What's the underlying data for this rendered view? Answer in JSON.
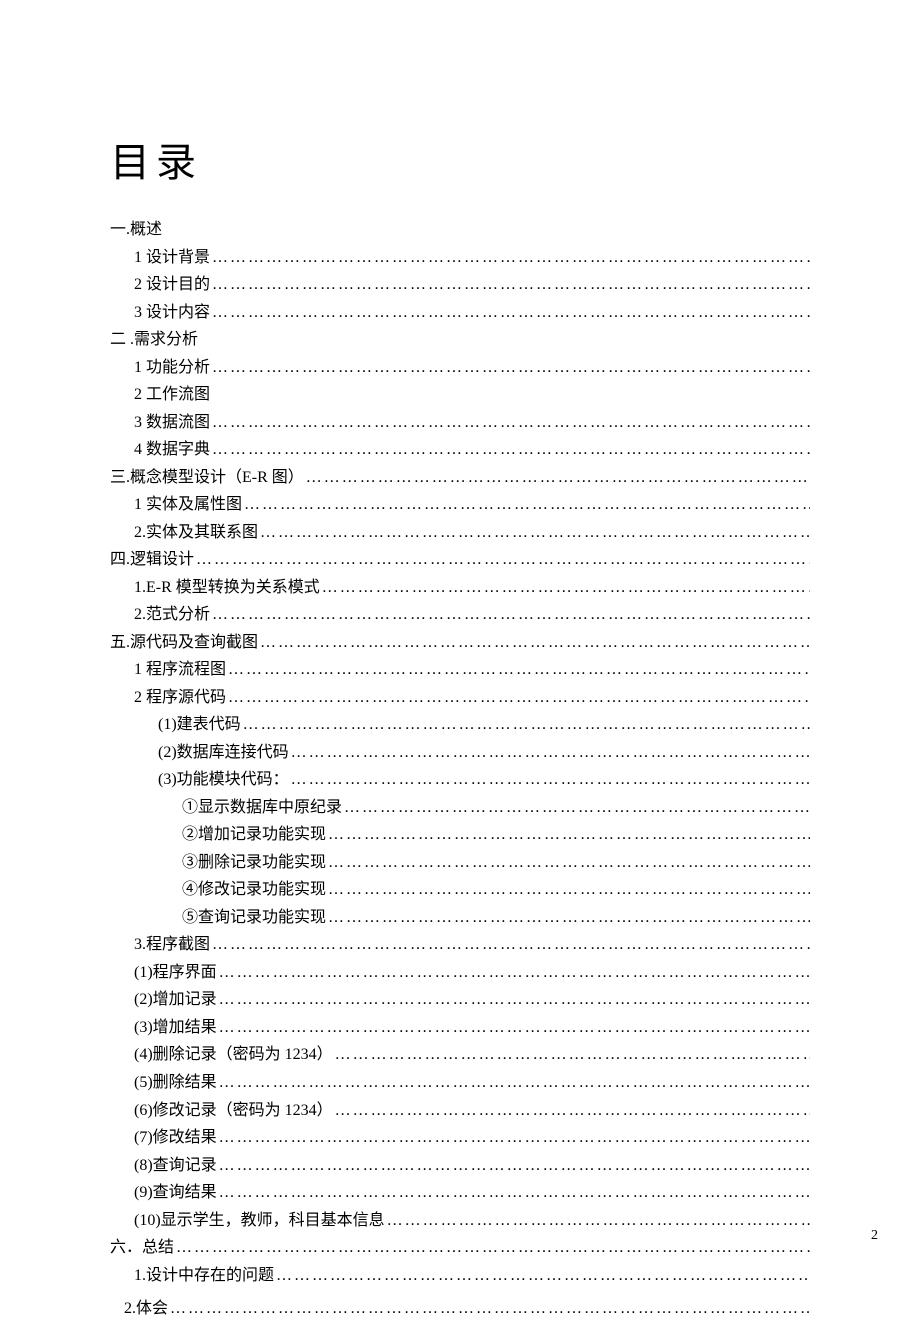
{
  "title": "目录",
  "page_number": "2",
  "toc": [
    {
      "indent": 0,
      "text": "一.概述",
      "dots": false
    },
    {
      "indent": 1,
      "text": "1 设计背景",
      "dots": true
    },
    {
      "indent": 1,
      "text": "2 设计目的",
      "dots": true
    },
    {
      "indent": 1,
      "text": "3 设计内容",
      "dots": true
    },
    {
      "indent": 0,
      "text": "二 .需求分析",
      "dots": false
    },
    {
      "indent": 1,
      "text": "1 功能分析",
      "dots": true
    },
    {
      "indent": 1,
      "text": "2 工作流图",
      "dots": false
    },
    {
      "indent": 1,
      "text": "3 数据流图",
      "dots": true
    },
    {
      "indent": 1,
      "text": "4 数据字典",
      "dots": true
    },
    {
      "indent": 0,
      "text": "三.概念模型设计（E-R 图）",
      "dots": true
    },
    {
      "indent": 1,
      "text": "1 实体及属性图",
      "dots": true
    },
    {
      "indent": 1,
      "text": "2.实体及其联系图",
      "dots": true
    },
    {
      "indent": 0,
      "text": "四.逻辑设计",
      "dots": true
    },
    {
      "indent": 1,
      "text": "1.E-R 模型转换为关系模式",
      "dots": true
    },
    {
      "indent": 1,
      "text": "2.范式分析",
      "dots": true
    },
    {
      "indent": 0,
      "text": "五.源代码及查询截图",
      "dots": true
    },
    {
      "indent": 1,
      "text": "1 程序流程图",
      "dots": true
    },
    {
      "indent": 1,
      "text": "2 程序源代码",
      "dots": true
    },
    {
      "indent": 2,
      "text": "(1)建表代码",
      "dots": true
    },
    {
      "indent": 2,
      "text": "(2)数据库连接代码",
      "dots": true
    },
    {
      "indent": 2,
      "text": "(3)功能模块代码：",
      "dots": true
    },
    {
      "indent": 3,
      "text": "①显示数据库中原纪录",
      "dots": true
    },
    {
      "indent": 3,
      "text": "②增加记录功能实现",
      "dots": true
    },
    {
      "indent": 3,
      "text": "③删除记录功能实现",
      "dots": true
    },
    {
      "indent": 3,
      "text": "④修改记录功能实现",
      "dots": true
    },
    {
      "indent": 3,
      "text": "⑤查询记录功能实现",
      "dots": true
    },
    {
      "indent": 1,
      "text": "3.程序截图",
      "dots": true
    },
    {
      "indent": 1,
      "text": "(1)程序界面",
      "dots": true
    },
    {
      "indent": 1,
      "text": "(2)增加记录",
      "dots": true
    },
    {
      "indent": 1,
      "text": "(3)增加结果",
      "dots": true
    },
    {
      "indent": 1,
      "text": "(4)删除记录（密码为 1234）",
      "dots": true
    },
    {
      "indent": 1,
      "text": "(5)删除结果",
      "dots": true
    },
    {
      "indent": 1,
      "text": "(6)修改记录（密码为 1234）",
      "dots": true
    },
    {
      "indent": 1,
      "text": "(7)修改结果",
      "dots": true
    },
    {
      "indent": 1,
      "text": "(8)查询记录",
      "dots": true
    },
    {
      "indent": 1,
      "text": "(9)查询结果",
      "dots": true
    },
    {
      "indent": 1,
      "text": "(10)显示学生，教师，科目基本信息",
      "dots": true
    },
    {
      "indent": 0,
      "text": "六．总结",
      "dots": true
    },
    {
      "indent": 1,
      "text": "1.设计中存在的问题",
      "dots": true
    },
    {
      "indent": 1,
      "text": "2.体会",
      "dots": true,
      "extraTop": 6,
      "customLeft": 14
    }
  ]
}
